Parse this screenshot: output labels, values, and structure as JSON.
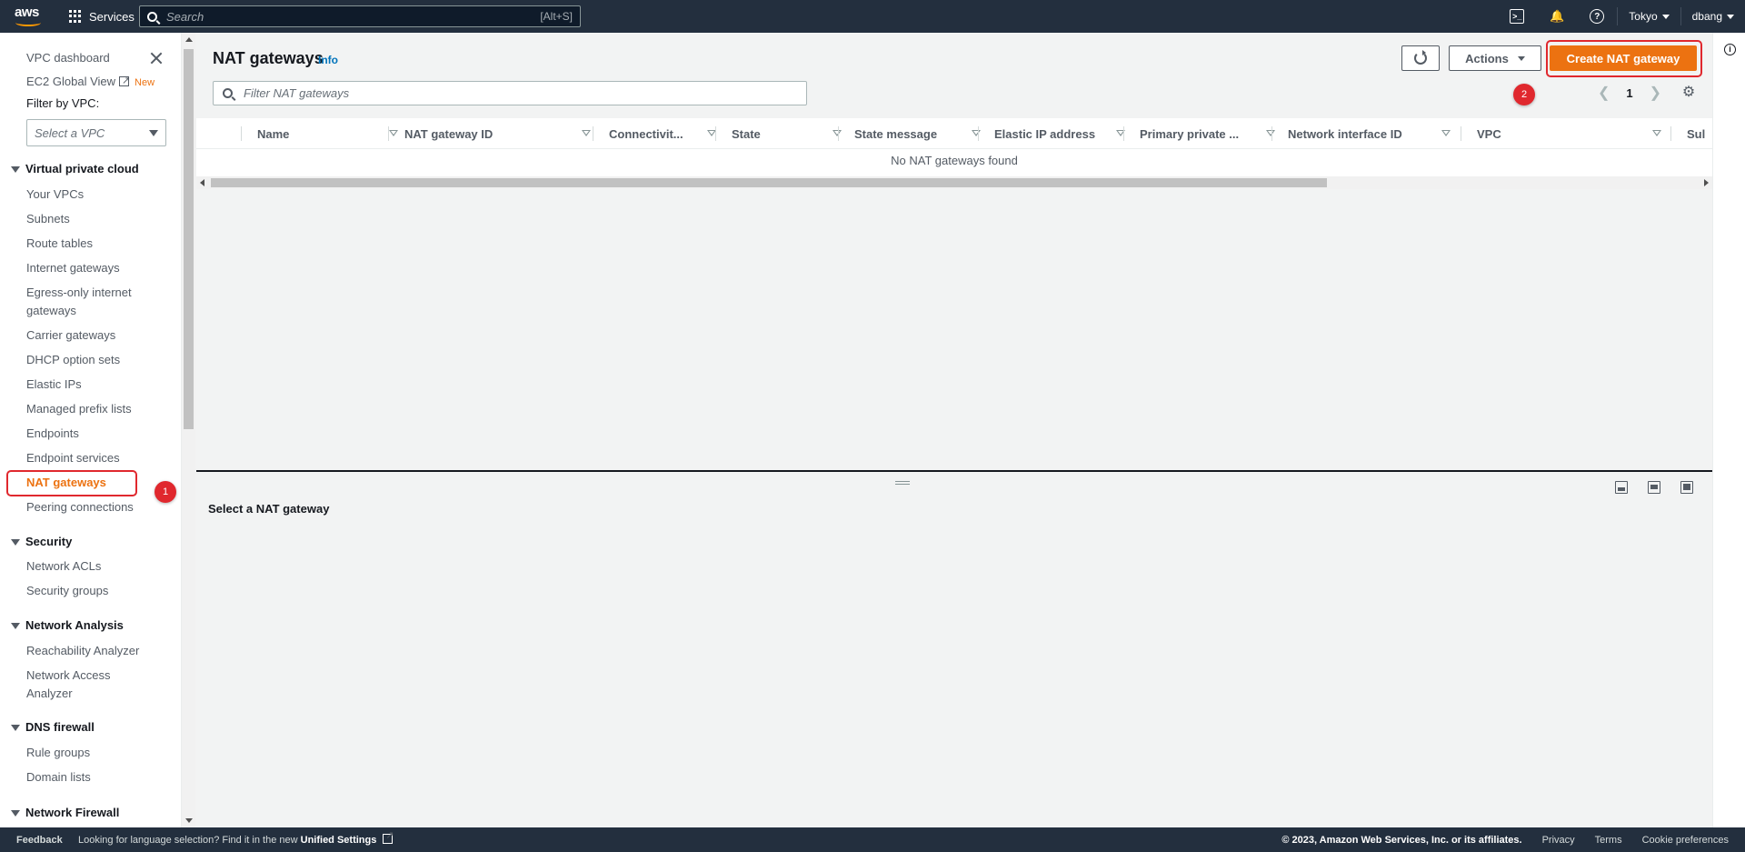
{
  "topbar": {
    "logo_text": "aws",
    "services_label": "Services",
    "search_placeholder": "Search",
    "search_hint": "[Alt+S]",
    "region": "Tokyo",
    "user": "dbang"
  },
  "sidebar": {
    "dashboard": "VPC dashboard",
    "global_view": "EC2 Global View",
    "new_badge": "New",
    "filter_label": "Filter by VPC:",
    "vpc_select_placeholder": "Select a VPC",
    "sections": [
      {
        "title": "Virtual private cloud",
        "items": [
          "Your VPCs",
          "Subnets",
          "Route tables",
          "Internet gateways",
          "Egress-only internet gateways",
          "Carrier gateways",
          "DHCP option sets",
          "Elastic IPs",
          "Managed prefix lists",
          "Endpoints",
          "Endpoint services",
          "NAT gateways",
          "Peering connections"
        ]
      },
      {
        "title": "Security",
        "items": [
          "Network ACLs",
          "Security groups"
        ]
      },
      {
        "title": "Network Analysis",
        "items": [
          "Reachability Analyzer",
          "Network Access Analyzer"
        ]
      },
      {
        "title": "DNS firewall",
        "items": [
          "Rule groups",
          "Domain lists"
        ]
      },
      {
        "title": "Network Firewall",
        "items": []
      }
    ],
    "active_item": "NAT gateways"
  },
  "annotations": {
    "step1": "1",
    "step2": "2",
    "highlight_color": "#e0282e"
  },
  "main": {
    "title": "NAT gateways",
    "info": "Info",
    "filter_placeholder": "Filter NAT gateways",
    "actions_label": "Actions",
    "create_label": "Create NAT gateway",
    "page_number": "1",
    "columns": [
      "Name",
      "NAT gateway ID",
      "Connectivit...",
      "State",
      "State message",
      "Elastic IP address",
      "Primary private ...",
      "Network interface ID",
      "VPC",
      "Sul"
    ],
    "empty_message": "No NAT gateways found",
    "split_title": "Select a NAT gateway",
    "accent_color": "#ec7211"
  },
  "footer": {
    "feedback": "Feedback",
    "lang_text": "Looking for language selection? Find it in the new",
    "lang_link": "Unified Settings",
    "copyright": "© 2023, Amazon Web Services, Inc. or its affiliates.",
    "privacy": "Privacy",
    "terms": "Terms",
    "cookies": "Cookie preferences"
  }
}
